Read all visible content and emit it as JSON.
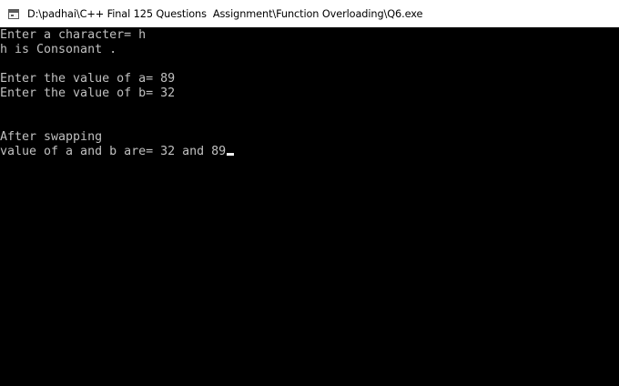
{
  "window": {
    "title": "D:\\padhai\\C++ Final 125 Questions  Assignment\\Function Overloading\\Q6.exe",
    "icon": "console-app-icon"
  },
  "console": {
    "lines": [
      "Enter a character= h",
      "h is Consonant .",
      "",
      "Enter the value of a= 89",
      "Enter the value of b= 32",
      "",
      "",
      "After swapping",
      "value of a and b are= 32 and 89"
    ],
    "text_color": "#c0c0c0",
    "background": "#000000"
  }
}
